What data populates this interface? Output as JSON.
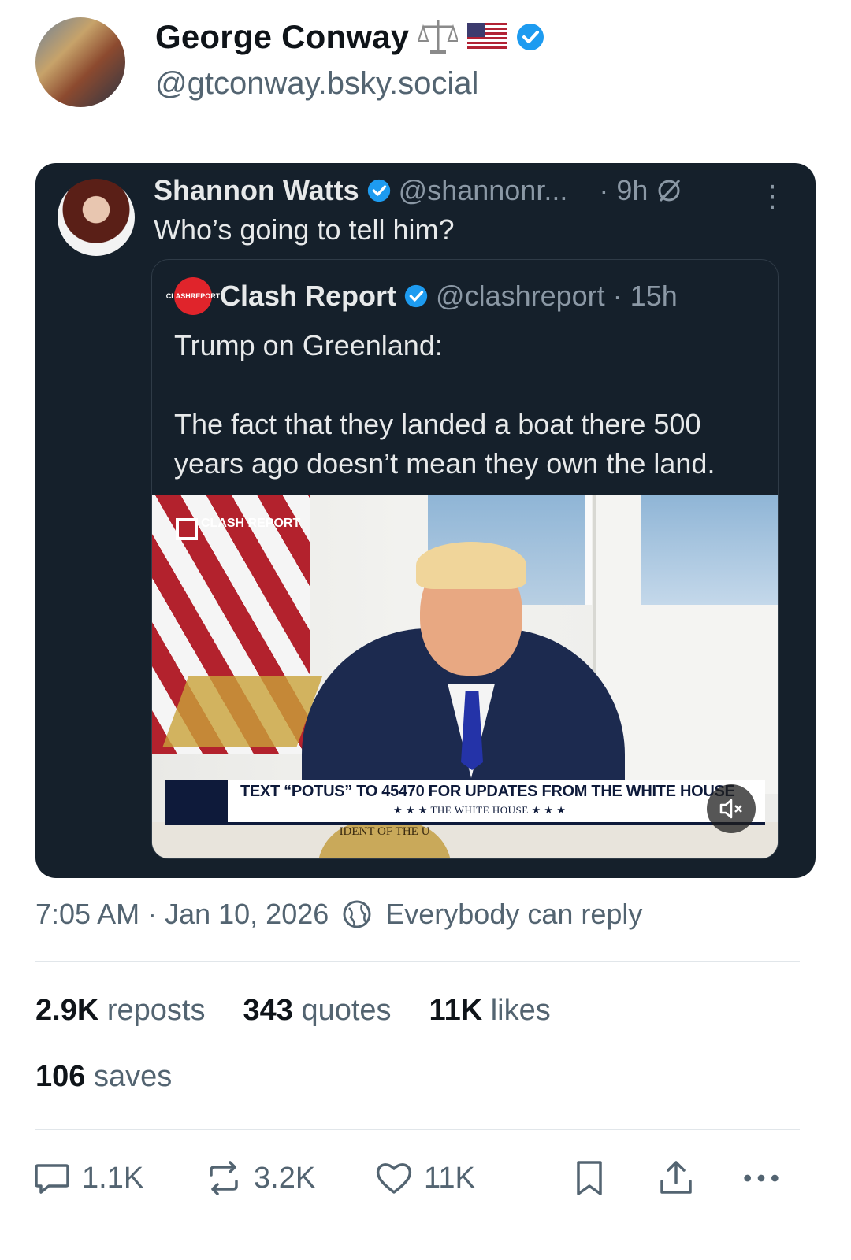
{
  "author": {
    "name": "George Conway",
    "handle": "@gtconway.bsky.social"
  },
  "quoted_post": {
    "author_name": "Shannon Watts",
    "author_handle": "@shannonr...",
    "time": "· 9h",
    "text": "Who’s going to tell him?",
    "embedded": {
      "author_name": "Clash Report",
      "author_handle": "@clashreport · 15h",
      "logo_text": "CLASH REPORT",
      "text": "Trump on Greenland:\n\nThe fact that they landed a boat there 500 years ago doesn’t mean they own the land.",
      "media": {
        "watermark": "CLASH REPORT",
        "lower_third": "TEXT “POTUS” TO 45470 FOR UPDATES FROM THE WHITE HOUSE",
        "lower_third_sub": "★ ★ ★  THE WHITE HOUSE  ★ ★ ★",
        "seal_text": "IDENT OF THE U"
      }
    }
  },
  "meta": {
    "timestamp": "7:05 AM · Jan 10, 2026",
    "reply_setting": "Everybody can reply"
  },
  "stats": {
    "reposts_count": "2.9K",
    "reposts_label": "reposts",
    "quotes_count": "343",
    "quotes_label": "quotes",
    "likes_count": "11K",
    "likes_label": "likes",
    "saves_count": "106",
    "saves_label": "saves"
  },
  "actions": {
    "replies": "1.1K",
    "reposts": "3.2K",
    "likes": "11K"
  },
  "colors": {
    "verified": "#1d9bf0",
    "card_bg": "#15202b",
    "muted": "#536471"
  }
}
